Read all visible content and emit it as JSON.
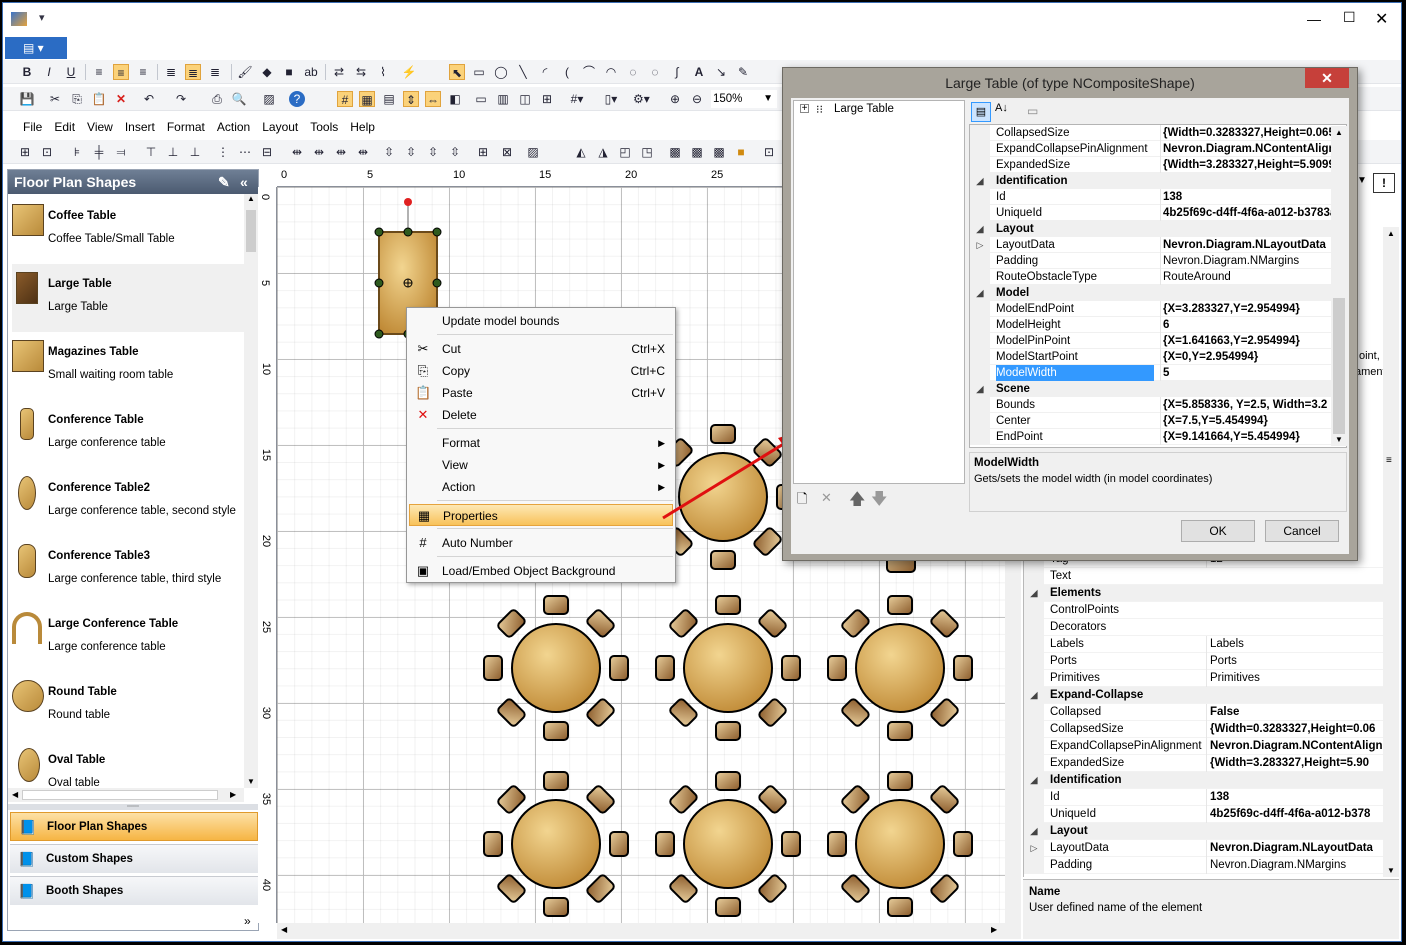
{
  "window": {
    "min": "—",
    "max": "☐",
    "close": "✕"
  },
  "zoom": "150%",
  "menu": [
    "File",
    "Edit",
    "View",
    "Insert",
    "Format",
    "Action",
    "Layout",
    "Tools",
    "Help"
  ],
  "left_panel": {
    "title": "Floor Plan Shapes",
    "shapes": [
      {
        "title": "Coffee Table",
        "desc": "Coffee Table/Small Table"
      },
      {
        "title": "Large Table",
        "desc": "Large Table"
      },
      {
        "title": "Magazines Table",
        "desc": "Small waiting room table"
      },
      {
        "title": "Conference Table",
        "desc": "Large conference table"
      },
      {
        "title": "Conference Table2",
        "desc": "Large conference table, second style"
      },
      {
        "title": "Conference Table3",
        "desc": "Large conference table, third style"
      },
      {
        "title": "Large Conference Table",
        "desc": "Large conference table"
      },
      {
        "title": "Round Table",
        "desc": "Round table"
      },
      {
        "title": "Oval Table",
        "desc": "Oval table"
      }
    ],
    "categories": [
      "Floor Plan Shapes",
      "Custom Shapes",
      "Booth Shapes"
    ]
  },
  "ruler": {
    "h": [
      "0",
      "5",
      "10",
      "15",
      "20",
      "25"
    ],
    "v": [
      "0",
      "5",
      "10",
      "15",
      "20",
      "25",
      "30",
      "35",
      "40"
    ]
  },
  "context_menu": [
    {
      "label": "Update model bounds"
    },
    {
      "label": "Cut",
      "shortcut": "Ctrl+X",
      "icon": "✂"
    },
    {
      "label": "Copy",
      "shortcut": "Ctrl+C",
      "icon": "⎘"
    },
    {
      "label": "Paste",
      "shortcut": "Ctrl+V",
      "icon": "📋"
    },
    {
      "label": "Delete",
      "icon": "✕"
    },
    {
      "label": "Format",
      "arrow": "▶"
    },
    {
      "label": "View",
      "arrow": "▶"
    },
    {
      "label": "Action",
      "arrow": "▶"
    },
    {
      "label": "Properties",
      "icon": "▦"
    },
    {
      "label": "Auto Number",
      "icon": "#"
    },
    {
      "label": "Load/Embed Object Background",
      "icon": "▣"
    }
  ],
  "dialog": {
    "title": "Large Table (of type NCompositeShape)",
    "close": "✕",
    "tree_root": "Large Table",
    "rows": [
      {
        "n": "CollapsedSize",
        "v": "{Width=0.3283327,Height=0.065",
        "b": true
      },
      {
        "n": "ExpandCollapsePinAlignment",
        "v": "Nevron.Diagram.NContentAlignm",
        "b": true
      },
      {
        "n": "ExpandedSize",
        "v": "{Width=3.283327,Height=5.9099",
        "b": true
      },
      {
        "cat": "Identification"
      },
      {
        "n": "Id",
        "v": "138",
        "b": true
      },
      {
        "n": "UniqueId",
        "v": "4b25f69c-d4ff-4f6a-a012-b3783a",
        "b": true
      },
      {
        "cat": "Layout"
      },
      {
        "n": "LayoutData",
        "v": "Nevron.Diagram.NLayoutData",
        "b": true,
        "exp": true
      },
      {
        "n": "Padding",
        "v": "Nevron.Diagram.NMargins"
      },
      {
        "n": "RouteObstacleType",
        "v": "RouteAround"
      },
      {
        "cat": "Model"
      },
      {
        "n": "ModelEndPoint",
        "v": "{X=3.283327,Y=2.954994}",
        "b": true
      },
      {
        "n": "ModelHeight",
        "v": "6",
        "b": true
      },
      {
        "n": "ModelPinPoint",
        "v": "{X=1.641663,Y=2.954994}",
        "b": true
      },
      {
        "n": "ModelStartPoint",
        "v": "{X=0,Y=2.954994}",
        "b": true
      },
      {
        "n": "ModelWidth",
        "v": "5",
        "b": true,
        "sel": true
      },
      {
        "cat": "Scene"
      },
      {
        "n": "Bounds",
        "v": "{X=5.858336, Y=2.5, Width=3.2",
        "b": true
      },
      {
        "n": "Center",
        "v": "{X=7.5,Y=5.454994}",
        "b": true
      },
      {
        "n": "EndPoint",
        "v": "{X=9.141664,Y=5.454994}",
        "b": true
      }
    ],
    "desc_title": "ModelWidth",
    "desc_text": "Gets/sets the model width (in model coordinates)",
    "ok": "OK",
    "cancel": "Cancel"
  },
  "right_props": {
    "rows": [
      {
        "n": "Tag",
        "v": "12"
      },
      {
        "n": "Text",
        "v": ""
      },
      {
        "cat": "Elements"
      },
      {
        "n": "ControlPoints",
        "v": ""
      },
      {
        "n": "Decorators",
        "v": ""
      },
      {
        "n": "Labels",
        "v": "Labels"
      },
      {
        "n": "Ports",
        "v": "Ports"
      },
      {
        "n": "Primitives",
        "v": "Primitives"
      },
      {
        "cat": "Expand-Collapse"
      },
      {
        "n": "Collapsed",
        "v": "False",
        "b": true
      },
      {
        "n": "CollapsedSize",
        "v": "{Width=0.3283327,Height=0.06",
        "b": true
      },
      {
        "n": "ExpandCollapsePinAlignment",
        "v": "Nevron.Diagram.NContentAlign",
        "b": true
      },
      {
        "n": "ExpandedSize",
        "v": "{Width=3.283327,Height=5.90",
        "b": true
      },
      {
        "cat": "Identification"
      },
      {
        "n": "Id",
        "v": "138",
        "b": true
      },
      {
        "n": "UniqueId",
        "v": "4b25f69c-d4ff-4f6a-a012-b378",
        "b": true
      },
      {
        "cat": "Layout"
      },
      {
        "n": "LayoutData",
        "v": "Nevron.Diagram.NLayoutData",
        "b": true,
        "exp": true
      },
      {
        "n": "Padding",
        "v": "Nevron.Diagram.NMargins"
      }
    ],
    "partial1": "oint, :",
    "partial2": "ament",
    "desc_title": "Name",
    "desc_text": "User defined name of the element"
  }
}
